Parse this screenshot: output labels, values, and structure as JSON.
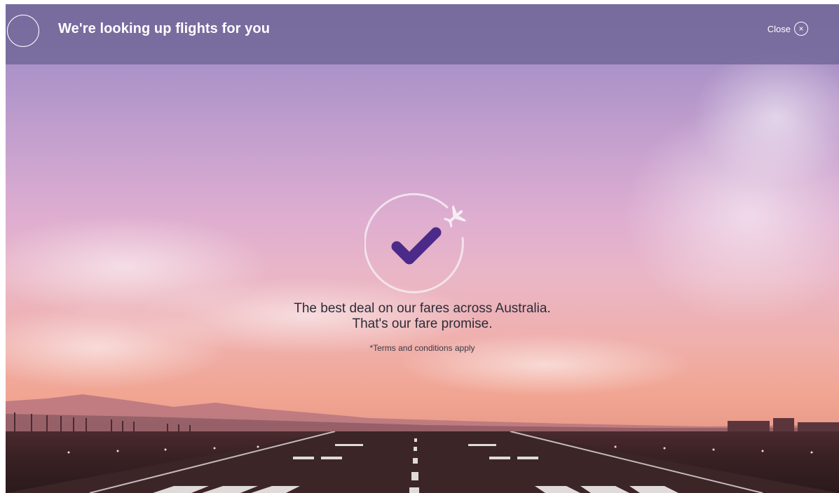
{
  "header": {
    "title": "We're looking up flights for you",
    "close_label": "Close",
    "close_icon": "close-icon",
    "progress_icon": "loading-ring-icon"
  },
  "promise": {
    "badge_icon": "checkmark-plane-icon",
    "line1": "The best deal on our fares across Australia.",
    "line2": "That's our fare promise.",
    "terms": "*Terms and conditions apply"
  },
  "colors": {
    "checkmark": "#4b2a8a",
    "header_bg": "#6e6496",
    "text_dark": "#2c2c38"
  }
}
